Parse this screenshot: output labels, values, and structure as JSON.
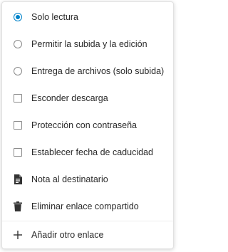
{
  "menu": {
    "items": [
      {
        "label": "Solo lectura",
        "icon": "radio-checked"
      },
      {
        "label": "Permitir la subida y la edición",
        "icon": "radio-unchecked"
      },
      {
        "label": "Entrega de archivos (solo subida)",
        "icon": "radio-unchecked"
      },
      {
        "label": "Esconder descarga",
        "icon": "checkbox-unchecked"
      },
      {
        "label": "Protección con contraseña",
        "icon": "checkbox-unchecked"
      },
      {
        "label": "Establecer fecha de caducidad",
        "icon": "checkbox-unchecked"
      },
      {
        "label": "Nota al destinatario",
        "icon": "document-icon"
      },
      {
        "label": "Eliminar enlace compartido",
        "icon": "trash-icon"
      },
      {
        "label": "Añadir otro enlace",
        "icon": "plus-icon"
      }
    ]
  },
  "colors": {
    "accent": "#0082c9",
    "text": "#2a2a2a",
    "icon": "#8a8a8a",
    "dark_icon": "#333333"
  }
}
